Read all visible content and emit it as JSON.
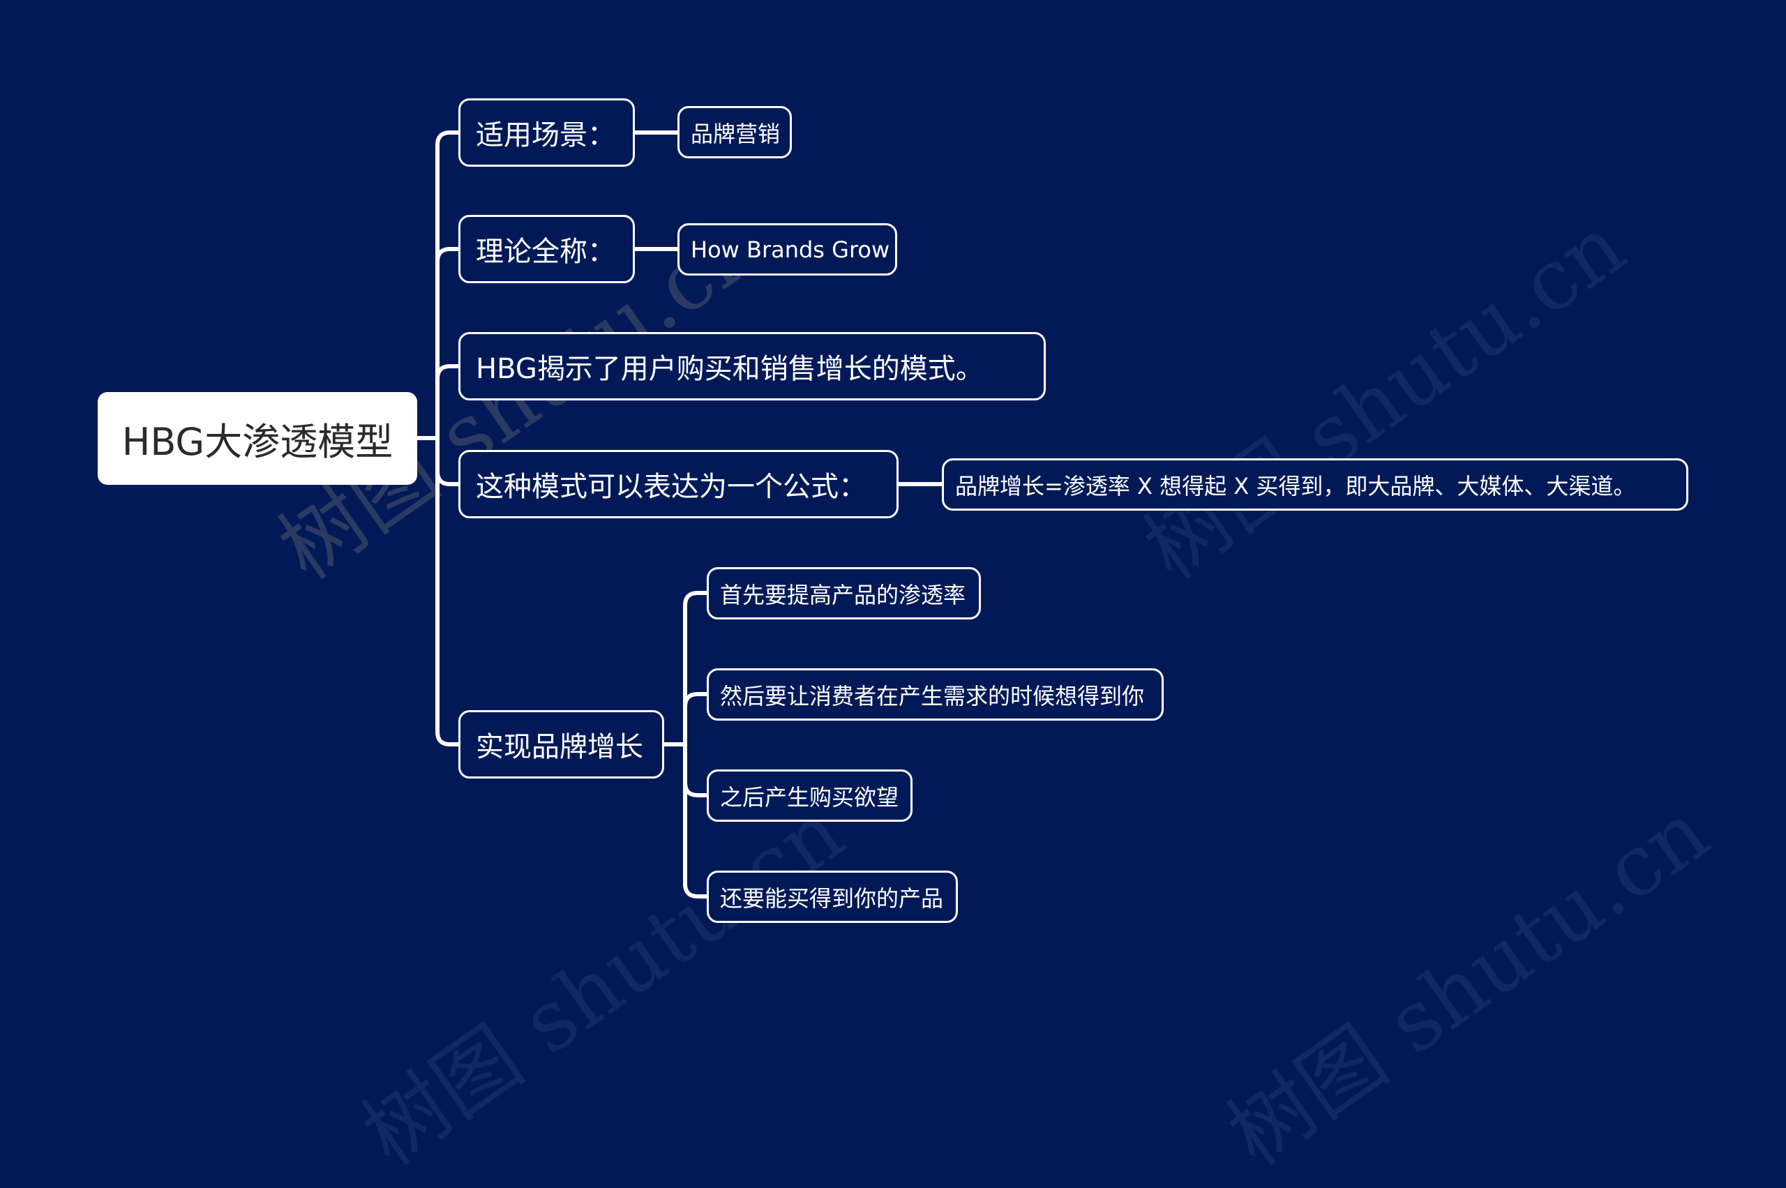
{
  "colors": {
    "background": "#011a57",
    "root_fill": "#ffffff",
    "root_text": "#2b2b2b",
    "node_border": "#ffffff",
    "node_text": "#ffffff",
    "connector": "#ffffff"
  },
  "watermark": "树图 shutu.cn",
  "root": {
    "label": "HBG大渗透模型"
  },
  "branches": [
    {
      "label": "适用场景：",
      "children": [
        {
          "label": "品牌营销"
        }
      ]
    },
    {
      "label": "理论全称：",
      "children": [
        {
          "label": "How Brands Grow"
        }
      ]
    },
    {
      "label": "HBG揭示了用户购买和销售增长的模式。",
      "children": []
    },
    {
      "label": "这种模式可以表达为一个公式：",
      "children": [
        {
          "label": "品牌增长=渗透率 X 想得起 X 买得到，即大品牌、大媒体、大渠道。"
        }
      ]
    },
    {
      "label": "实现品牌增长",
      "children": [
        {
          "label": "首先要提高产品的渗透率"
        },
        {
          "label": "然后要让消费者在产生需求的时候想得到你"
        },
        {
          "label": "之后产生购买欲望"
        },
        {
          "label": "还要能买得到你的产品"
        }
      ]
    }
  ]
}
